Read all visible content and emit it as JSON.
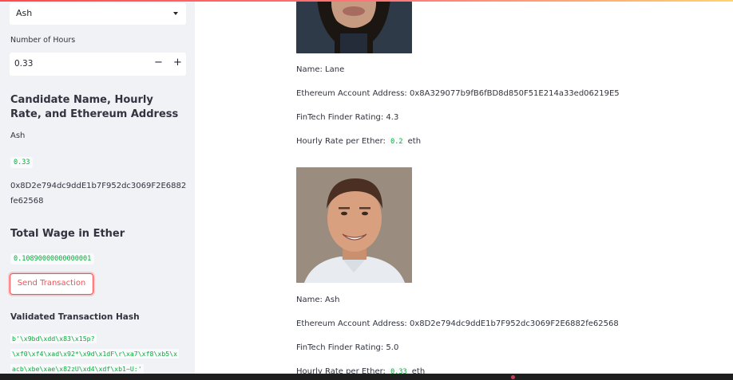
{
  "sidebar": {
    "candidate_select": {
      "value": "Ash"
    },
    "hours_label": "Number of Hours",
    "hours_input": {
      "value": "0.33",
      "minus": "−",
      "plus": "+"
    },
    "candidate_heading": "Candidate Name, Hourly Rate, and Ethereum Address",
    "candidate_name": "Ash",
    "candidate_rate": "0.33",
    "candidate_address": "0x8D2e794dc9ddE1b7F952dc3069F2E6882fe62568",
    "wage_heading": "Total Wage in Ether",
    "wage_value": "0.10890000000000001",
    "send_button": "Send Transaction",
    "hash_heading": "Validated Transaction Hash",
    "hash_lines": [
      "b'\\x9bd\\xdd\\x83\\x15p?",
      "\\xf0\\xf4\\xad\\x92*\\x9d\\x1dF\\r\\xa7\\xf8\\xb5\\x",
      "acb\\xbe\\xae\\x82zU\\xd4\\xdf\\xb1~U:'"
    ]
  },
  "main": {
    "candidates": [
      {
        "name": "Name: Lane",
        "address": "Ethereum Account Address: 0x8A329077b9fB6fBD8d850F51E214a33ed06219E5",
        "rating": "FinTech Finder Rating: 4.3",
        "rate_label": "Hourly Rate per Ether:",
        "rate_value": "0.2",
        "rate_unit": "eth"
      },
      {
        "name": "Name: Ash",
        "address": "Ethereum Account Address: 0x8D2e794dc9ddE1b7F952dc3069F2E6882fe62568",
        "rating": "FinTech Finder Rating: 5.0",
        "rate_label": "Hourly Rate per Ether:",
        "rate_value": "0.33",
        "rate_unit": "eth"
      }
    ]
  },
  "colors": {
    "accent": "#ff4b4b",
    "code_green": "#09ab3b",
    "sidebar_bg": "#f0f2f6"
  }
}
